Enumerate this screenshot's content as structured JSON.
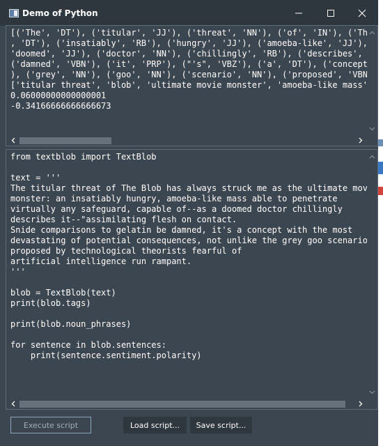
{
  "window": {
    "title": "Demo of Python",
    "colors": {
      "background": "#3c4650",
      "titlebar": "#2e363e",
      "text": "#ffffff",
      "border": "#5f6a74"
    }
  },
  "output_panel": {
    "lines": [
      "[('The', 'DT'), ('titular', 'JJ'), ('threat', 'NN'), ('of', 'IN'), ('The', 'NNP'), ('Blob', 'NNP')",
      ", 'DT'), ('insatiably', 'RB'), ('hungry', 'JJ'), ('amoeba-like', 'JJ'), ('mass', 'NN'),",
      "'doomed', 'JJ'), ('doctor', 'NN'), ('chillingly', 'RB'), ('describes', 'VBZ'), ('it', 'PRP'),",
      "('damned', 'VBN'), ('it', 'PRP'), (\"'s\", 'VBZ'), ('a', 'DT'), ('concept', 'NN'), ('with', 'IN'),",
      "), ('grey', 'NN'), ('goo', 'NN'), ('scenario', 'NN'), ('proposed', 'VBN'), ('by', 'IN'),",
      "['titular threat', 'blob', 'ultimate movie monster', 'amoeba-like mass', 'safeguard']",
      "0.06000000000000001",
      "-0.34166666666666673"
    ]
  },
  "editor_panel": {
    "lines": [
      "from textblob import TextBlob",
      "",
      "text = '''",
      "The titular threat of The Blob has always struck me as the ultimate movie",
      "monster: an insatiably hungry, amoeba-like mass able to penetrate",
      "virtually any safeguard, capable of--as a doomed doctor chillingly",
      "describes it--\"assimilating flesh on contact.",
      "Snide comparisons to gelatin be damned, it's a concept with the most",
      "devastating of potential consequences, not unlike the grey goo scenario",
      "proposed by technological theorists fearful of",
      "artificial intelligence run rampant.",
      "'''",
      "",
      "blob = TextBlob(text)",
      "print(blob.tags)",
      "",
      "print(blob.noun_phrases)",
      "",
      "for sentence in blob.sentences:",
      "    print(sentence.sentiment.polarity)"
    ]
  },
  "buttons": {
    "execute": "Execute script",
    "load": "Load script...",
    "save": "Save script..."
  }
}
